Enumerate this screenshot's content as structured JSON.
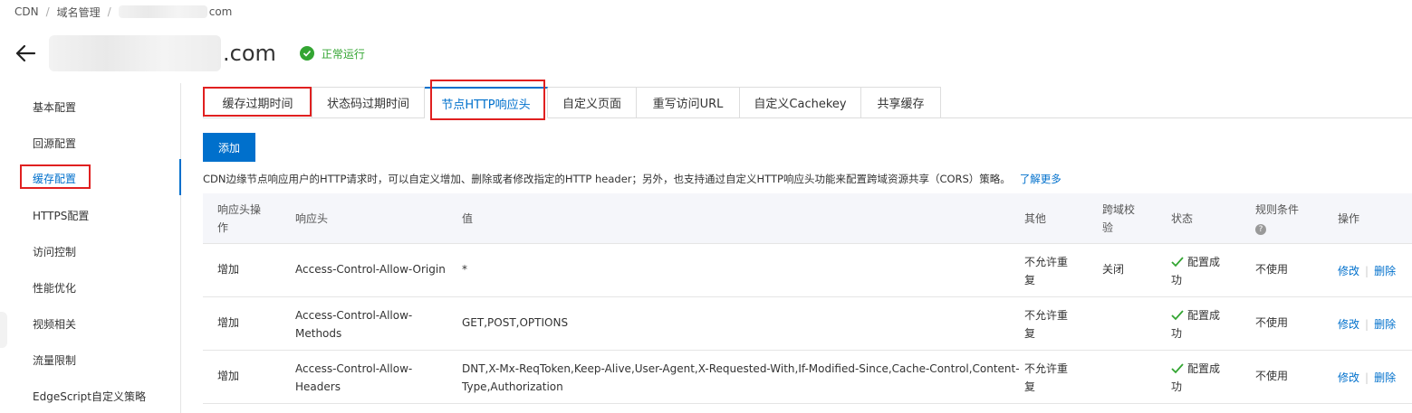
{
  "breadcrumb": {
    "items": [
      "CDN",
      "域名管理"
    ],
    "domain_suffix": "com"
  },
  "header": {
    "title_suffix": ".com",
    "status": "正常运行"
  },
  "sidebar": {
    "items": [
      "基本配置",
      "回源配置",
      "缓存配置",
      "HTTPS配置",
      "访问控制",
      "性能优化",
      "视频相关",
      "流量限制",
      "EdgeScript自定义策略"
    ],
    "active_index": 2
  },
  "tabs": [
    "缓存过期时间",
    "状态码过期时间",
    "节点HTTP响应头",
    "自定义页面",
    "重写访问URL",
    "自定义Cachekey",
    "共享缓存"
  ],
  "active_tab": 2,
  "toolbar": {
    "add_label": "添加"
  },
  "description": {
    "text": "CDN边缘节点响应用户的HTTP请求时，可以自定义增加、删除或者修改指定的HTTP header；另外，也支持通过自定义HTTP响应头功能来配置跨域资源共享（CORS）策略。",
    "link": "了解更多"
  },
  "table": {
    "columns": {
      "op_line1": "响应头操",
      "op_line2": "作",
      "header": "响应头",
      "value": "值",
      "other": "其他",
      "cors_line1": "跨域校",
      "cors_line2": "验",
      "status": "状态",
      "rule_line1": "规则条件",
      "rule_help": "?",
      "action": "操作"
    },
    "rows": [
      {
        "op": "增加",
        "header_l1": "Access-Control-Allow-Origin",
        "header_l2": "",
        "value_l1": "*",
        "value_l2": "",
        "other_l1": "不允许重",
        "other_l2": "复",
        "cors": "关闭",
        "status_l1": "配置成",
        "status_l2": "功",
        "rule": "不使用",
        "edit": "修改",
        "delete": "删除"
      },
      {
        "op": "增加",
        "header_l1": "Access-Control-Allow-",
        "header_l2": "Methods",
        "value_l1": "GET,POST,OPTIONS",
        "value_l2": "",
        "other_l1": "不允许重",
        "other_l2": "复",
        "cors": "",
        "status_l1": "配置成",
        "status_l2": "功",
        "rule": "不使用",
        "edit": "修改",
        "delete": "删除"
      },
      {
        "op": "增加",
        "header_l1": "Access-Control-Allow-",
        "header_l2": "Headers",
        "value_l1": "DNT,X-Mx-ReqToken,Keep-Alive,User-Agent,X-Requested-With,If-Modified-Since,Cache-Control,Content-",
        "value_l2": "Type,Authorization",
        "other_l1": "不允许重",
        "other_l2": "复",
        "cors": "",
        "status_l1": "配置成",
        "status_l2": "功",
        "rule": "不使用",
        "edit": "修改",
        "delete": "删除"
      }
    ]
  },
  "colors": {
    "primary": "#0070cc",
    "success": "#33a532",
    "highlight_box": "#e02020"
  }
}
